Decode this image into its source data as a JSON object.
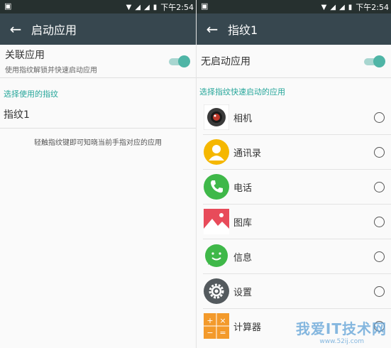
{
  "status": {
    "time": "下午2:54"
  },
  "left": {
    "title": "启动应用",
    "toggle_label": "关联应用",
    "toggle_sublabel": "使用指纹解锁并快速启动应用",
    "toggle_on": true,
    "section_header": "选择使用的指纹",
    "fingerprint_item": "指纹1",
    "hint": "轻触指纹键即可知晓当前手指对应的应用"
  },
  "right": {
    "title": "指纹1",
    "toggle_label": "无启动应用",
    "toggle_on": true,
    "section_header": "选择指纹快速启动的应用",
    "apps": [
      {
        "name": "相机",
        "icon": "camera-icon"
      },
      {
        "name": "通讯录",
        "icon": "contacts-icon"
      },
      {
        "name": "电话",
        "icon": "phone-icon"
      },
      {
        "name": "图库",
        "icon": "gallery-icon"
      },
      {
        "name": "信息",
        "icon": "messages-icon"
      },
      {
        "name": "设置",
        "icon": "settings-icon"
      },
      {
        "name": "计算器",
        "icon": "calculator-icon"
      }
    ]
  },
  "watermark": {
    "text": "我爱IT技术网",
    "url": "www.52ij.com"
  },
  "colors": {
    "accent": "#26a69a",
    "titlebar": "#37474f",
    "statusbar": "#26302f"
  }
}
